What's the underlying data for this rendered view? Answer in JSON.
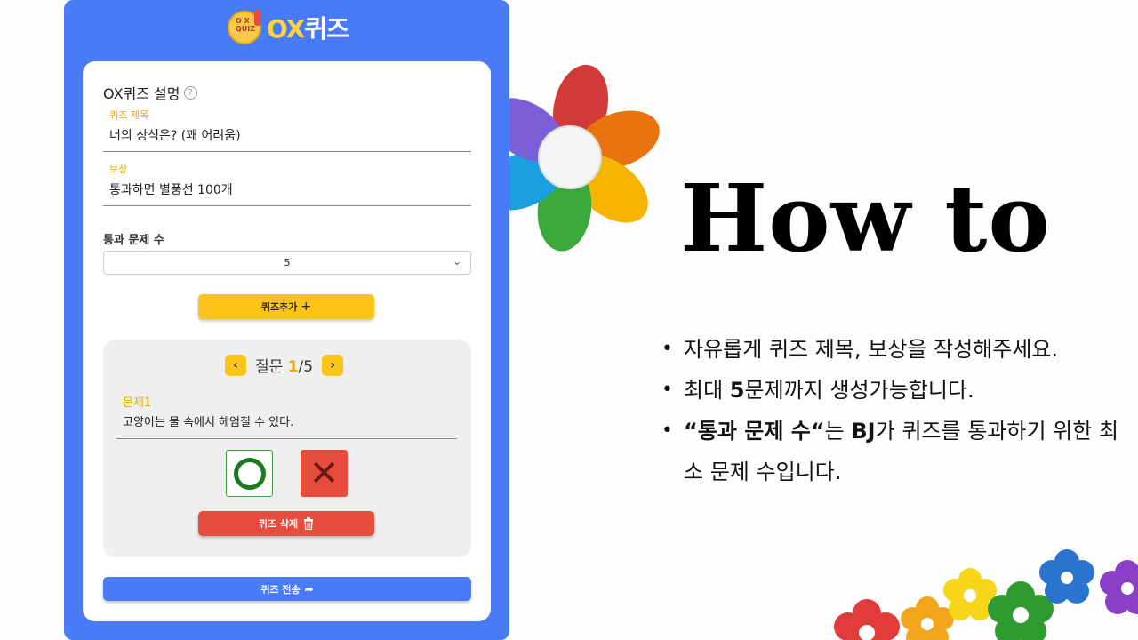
{
  "logo": {
    "prefix": "OX",
    "suffix": "퀴즈",
    "badge_text": "O X QUIZ"
  },
  "form": {
    "section_title": "OX퀴즈 설명",
    "help_icon": "?",
    "quiz_title": {
      "label": "퀴즈 제목",
      "value": "너의 상식은? (꽤 어려움)"
    },
    "reward": {
      "label": "보상",
      "value": "통과하면 별풍선 100개"
    },
    "pass_count": {
      "label": "통과 문제 수",
      "value": "5",
      "chevron": "⌄"
    },
    "add_button": {
      "label": "퀴즈추가",
      "icon": "+"
    }
  },
  "question": {
    "nav_prev": "‹",
    "nav_next": "›",
    "nav_label": "질문",
    "current": "1",
    "separator": "/",
    "total": "5",
    "field_label": "문제1",
    "text": "고양이는 물 속에서 헤엄칠 수 있다.",
    "x_mark": "✕",
    "delete_button": {
      "label": "퀴즈 삭제"
    }
  },
  "send_button": {
    "label": "퀴즈 전송",
    "icon": "➦"
  },
  "heading": "How to",
  "bullets": [
    {
      "parts": [
        {
          "t": "자유롭게 퀴즈 제목, 보상을 작성해주세요."
        }
      ]
    },
    {
      "parts": [
        {
          "t": "최대 "
        },
        {
          "t": "5",
          "b": true
        },
        {
          "t": "문제까지 생성가능합니다."
        }
      ]
    },
    {
      "parts": [
        {
          "t": "“통과 문제 수“",
          "b": true
        },
        {
          "t": "는 "
        },
        {
          "t": "BJ",
          "b": true
        },
        {
          "t": "가 퀴즈를 통과하기 위한 최소 문제 수입니다."
        }
      ]
    }
  ],
  "colors": {
    "panel_blue": "#4a7bf7",
    "accent_yellow": "#fcc419",
    "danger_red": "#e74c3c",
    "o_green": "#1f7a1f"
  },
  "icons": [
    "help-icon",
    "chevron-down-icon",
    "plus-icon",
    "chevron-left-icon",
    "chevron-right-icon",
    "o-mark-icon",
    "x-mark-icon",
    "trash-icon",
    "share-arrow-icon",
    "flower-decoration"
  ]
}
